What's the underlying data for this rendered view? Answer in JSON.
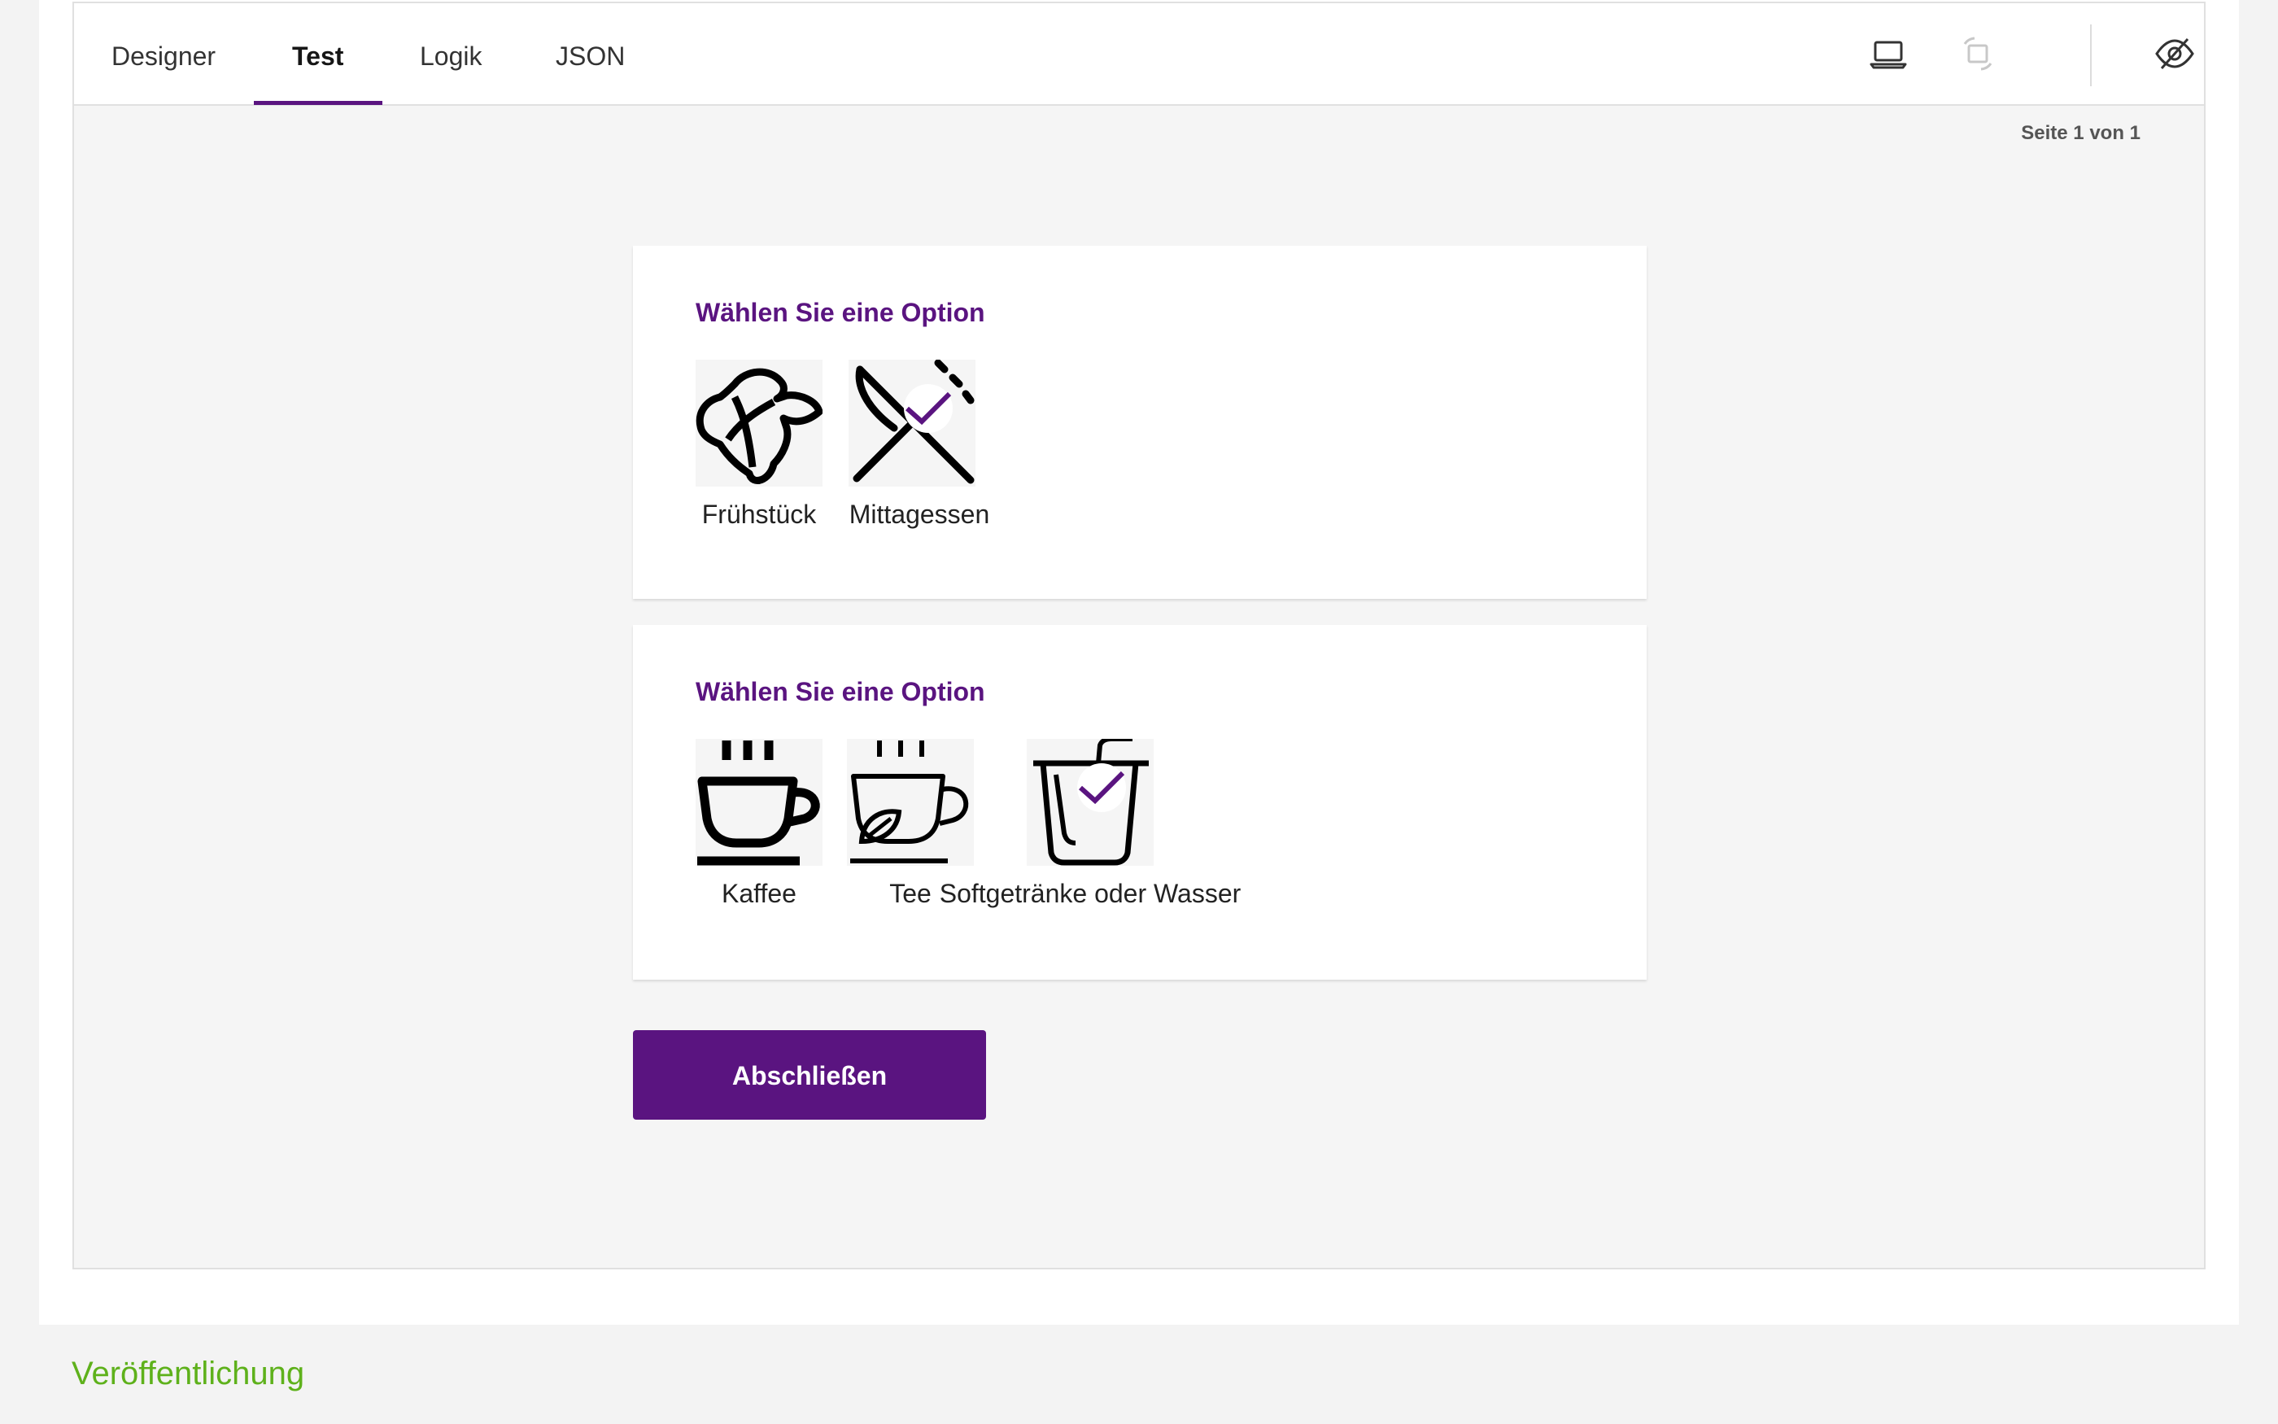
{
  "tabs": [
    {
      "label": "Designer"
    },
    {
      "label": "Test"
    },
    {
      "label": "Logik"
    },
    {
      "label": "JSON"
    }
  ],
  "toolbar": {
    "device_icon": "laptop-icon",
    "orientation_icon": "rotate-device-icon",
    "visibility_icon": "eye-slash-icon"
  },
  "page_indicator": "Seite 1 von 1",
  "questions": [
    {
      "title": "Wählen Sie eine Option",
      "choices": [
        {
          "label": "Frühstück",
          "icon": "croissant-icon",
          "selected": false
        },
        {
          "label": "Mittagessen",
          "icon": "knife-fork-icon",
          "selected": true
        }
      ]
    },
    {
      "title": "Wählen Sie eine Option",
      "choices": [
        {
          "label": "Kaffee",
          "icon": "coffee-cup-icon",
          "selected": false
        },
        {
          "label": "Tee",
          "icon": "tea-cup-icon",
          "selected": false
        },
        {
          "label": "Softgetränke oder Wasser",
          "icon": "drink-glass-icon",
          "selected": true
        }
      ]
    }
  ],
  "complete_button": "Abschließen",
  "publish_section_title": "Veröffentlichung",
  "colors": {
    "accent": "#5a1480",
    "publish_green": "#5eb11b",
    "canvas": "#f5f5f5"
  }
}
